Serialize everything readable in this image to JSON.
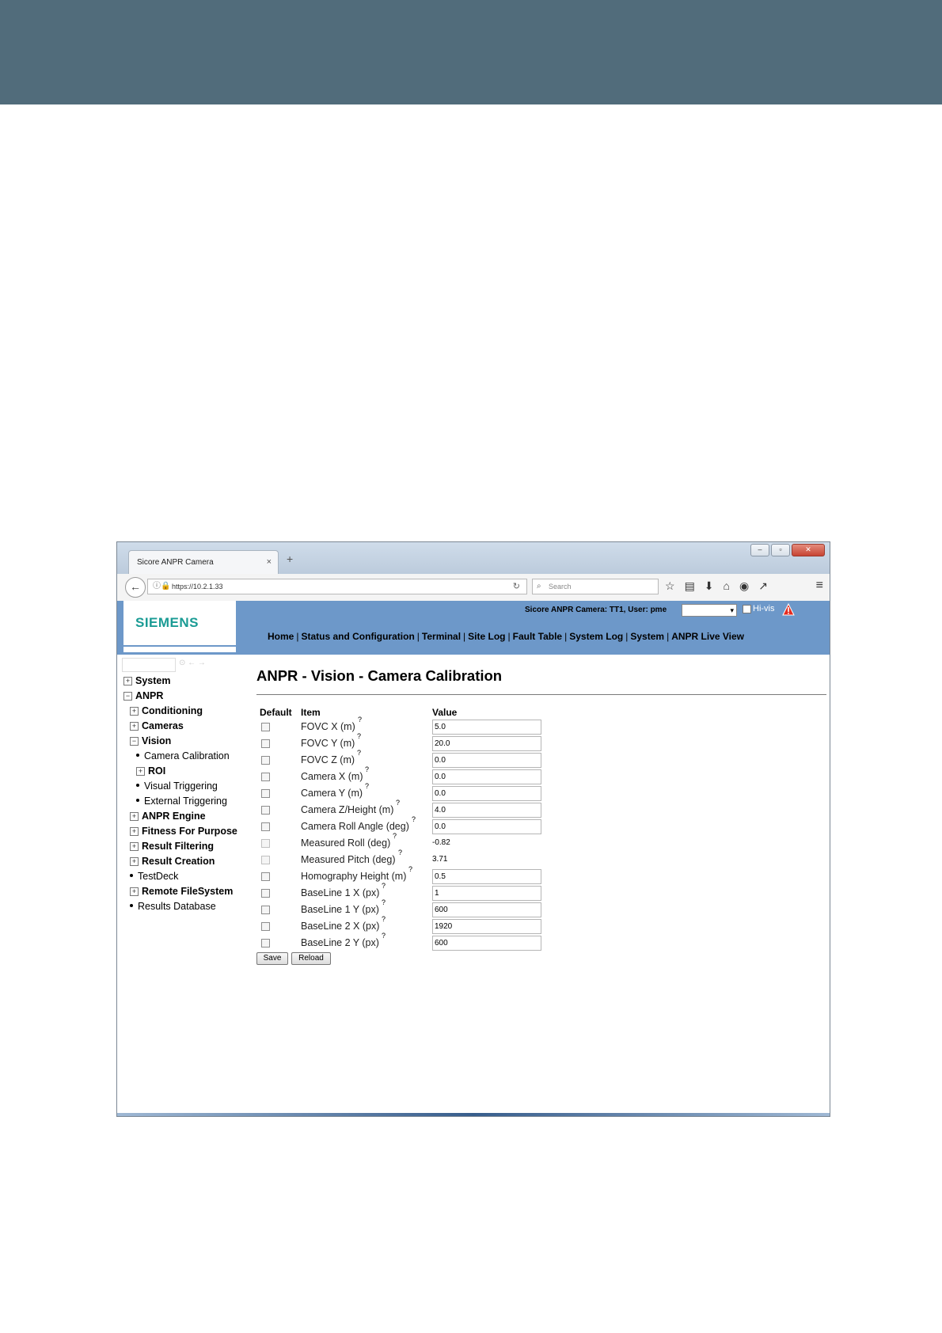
{
  "browser": {
    "tab_title": "Sicore ANPR Camera",
    "tab_close": "×",
    "new_tab": "+",
    "url": "https://10.2.1.33",
    "search_placeholder": "Search",
    "window_controls": [
      "minimize-icon",
      "restore-icon",
      "close-icon"
    ],
    "toolbar_icons": [
      "star-icon",
      "clipboard-icon",
      "download-icon",
      "home-icon",
      "pocket-icon",
      "share-icon",
      "menu-icon"
    ]
  },
  "header": {
    "logo": "SIEMENS",
    "user_info": "Sicore ANPR Camera: TT1, User: pme",
    "hivis_label": "Hi-vis",
    "nav": [
      "Home",
      "Status and Configuration",
      "Terminal",
      "Site Log",
      "Fault Table",
      "System Log",
      "System",
      "ANPR Live View"
    ],
    "nav_separator": "|"
  },
  "sidebar": {
    "tree": [
      {
        "label": "System",
        "kind": "plus",
        "level": 0,
        "bold": true
      },
      {
        "label": "ANPR",
        "kind": "minus",
        "level": 0,
        "bold": true
      },
      {
        "label": "Conditioning",
        "kind": "plus",
        "level": 1,
        "bold": true
      },
      {
        "label": "Cameras",
        "kind": "plus",
        "level": 1,
        "bold": true
      },
      {
        "label": "Vision",
        "kind": "minus",
        "level": 1,
        "bold": true
      },
      {
        "label": "Camera Calibration",
        "kind": "bullet",
        "level": 2,
        "bold": false
      },
      {
        "label": "ROI",
        "kind": "plus",
        "level": 2,
        "bold": true
      },
      {
        "label": "Visual Triggering",
        "kind": "bullet",
        "level": 2,
        "bold": false
      },
      {
        "label": "External Triggering",
        "kind": "bullet",
        "level": 2,
        "bold": false
      },
      {
        "label": "ANPR Engine",
        "kind": "plus",
        "level": 1,
        "bold": true
      },
      {
        "label": "Fitness For Purpose",
        "kind": "plus",
        "level": 1,
        "bold": true
      },
      {
        "label": "Result Filtering",
        "kind": "plus",
        "level": 1,
        "bold": true
      },
      {
        "label": "Result Creation",
        "kind": "plus",
        "level": 1,
        "bold": true
      },
      {
        "label": "TestDeck",
        "kind": "bullet",
        "level": 1,
        "bold": false
      },
      {
        "label": "Remote FileSystem",
        "kind": "plus",
        "level": 1,
        "bold": true
      },
      {
        "label": "Results Database",
        "kind": "bullet",
        "level": 1,
        "bold": false
      }
    ]
  },
  "main": {
    "title": "ANPR - Vision - Camera Calibration",
    "columns": {
      "default": "Default",
      "item": "Item",
      "value": "Value"
    },
    "help_mark": "?",
    "rows": [
      {
        "item": "FOVC X (m)",
        "value": "5.0",
        "editable": true
      },
      {
        "item": "FOVC Y (m)",
        "value": "20.0",
        "editable": true
      },
      {
        "item": "FOVC Z (m)",
        "value": "0.0",
        "editable": true
      },
      {
        "item": "Camera X (m)",
        "value": "0.0",
        "editable": true
      },
      {
        "item": "Camera Y (m)",
        "value": "0.0",
        "editable": true
      },
      {
        "item": "Camera Z/Height (m)",
        "value": "4.0",
        "editable": true
      },
      {
        "item": "Camera Roll Angle (deg)",
        "value": "0.0",
        "editable": true
      },
      {
        "item": "Measured Roll (deg)",
        "value": "-0.82",
        "editable": false
      },
      {
        "item": "Measured Pitch (deg)",
        "value": "3.71",
        "editable": false
      },
      {
        "item": "Homography Height (m)",
        "value": "0.5",
        "editable": true
      },
      {
        "item": "BaseLine 1 X (px)",
        "value": "1",
        "editable": true
      },
      {
        "item": "BaseLine 1 Y (px)",
        "value": "600",
        "editable": true
      },
      {
        "item": "BaseLine 2 X (px)",
        "value": "1920",
        "editable": true
      },
      {
        "item": "BaseLine 2 Y (px)",
        "value": "600",
        "editable": true
      }
    ],
    "save_label": "Save",
    "reload_label": "Reload"
  },
  "colors": {
    "band": "#516c7b",
    "header": "#6d98c9",
    "logo": "#1a9b94"
  }
}
